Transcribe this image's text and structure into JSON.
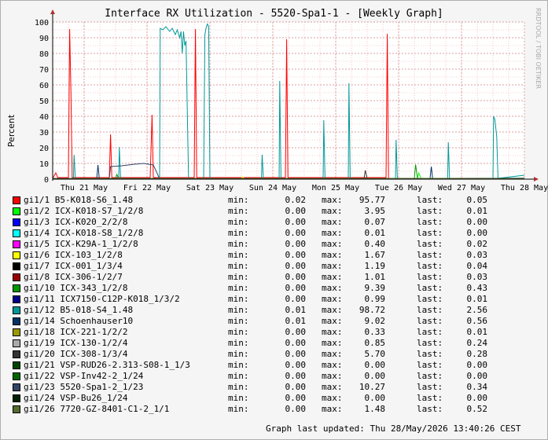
{
  "chart_data": {
    "type": "line",
    "title": "Interface RX Utilization - 5520-Spa1-1 - [Weekly Graph]",
    "ylabel": "Percent",
    "watermark": "RRDTOOL / TOBI OETIKER",
    "ylim": [
      0,
      100
    ],
    "yticks": [
      0,
      10,
      20,
      30,
      40,
      50,
      60,
      70,
      80,
      90,
      100
    ],
    "x_range_days": [
      0,
      7.5
    ],
    "xticks": [
      {
        "label": "Thu 21 May",
        "day": 0.5
      },
      {
        "label": "Fri 22 May",
        "day": 1.5
      },
      {
        "label": "Sat 23 May",
        "day": 2.5
      },
      {
        "label": "Sun 24 May",
        "day": 3.5
      },
      {
        "label": "Mon 25 May",
        "day": 4.5
      },
      {
        "label": "Tue 26 May",
        "day": 5.5
      },
      {
        "label": "Wed 27 May",
        "day": 6.5
      },
      {
        "label": "Thu 28 May",
        "day": 7.5
      }
    ],
    "grid": true,
    "minor_grid": "dotted red",
    "series": [
      {
        "name": "gi1/1 B5-K018-S6_1.48",
        "color": "#ff0000",
        "min": "0.02",
        "max": "95.77",
        "last": "0.05",
        "points": [
          [
            0,
            0.5
          ],
          [
            0.05,
            4
          ],
          [
            0.08,
            1
          ],
          [
            0.25,
            1
          ],
          [
            0.27,
            95.5
          ],
          [
            0.29,
            56
          ],
          [
            0.31,
            1
          ],
          [
            0.9,
            1
          ],
          [
            0.92,
            28.5
          ],
          [
            0.94,
            1
          ],
          [
            1.55,
            1
          ],
          [
            1.58,
            41
          ],
          [
            1.6,
            1
          ],
          [
            2.25,
            1
          ],
          [
            2.27,
            95.5
          ],
          [
            2.29,
            1
          ],
          [
            3.7,
            1
          ],
          [
            3.72,
            89
          ],
          [
            3.74,
            1
          ],
          [
            5.3,
            1
          ],
          [
            5.32,
            92.5
          ],
          [
            5.34,
            0.5
          ],
          [
            7.5,
            0.2
          ]
        ]
      },
      {
        "name": "gi1/2 ICX-K018-S7_1/2/8",
        "color": "#00ff00",
        "min": "0.00",
        "max": "3.95",
        "last": "0.01",
        "points": [
          [
            0,
            0.2
          ],
          [
            5.8,
            0.3
          ],
          [
            5.82,
            3.9
          ],
          [
            5.86,
            0.3
          ],
          [
            7.5,
            0.1
          ]
        ]
      },
      {
        "name": "gi1/3 ICX-K020_2/2/8",
        "color": "#0000ff",
        "min": "0.00",
        "max": "0.07",
        "last": "0.00",
        "points": [
          [
            0,
            0.05
          ],
          [
            7.5,
            0.02
          ]
        ]
      },
      {
        "name": "gi1/4 ICX-K018-S8_1/2/8",
        "color": "#00ffff",
        "min": "0.00",
        "max": "0.01",
        "last": "0.00",
        "points": [
          [
            0,
            0.01
          ],
          [
            7.5,
            0.01
          ]
        ]
      },
      {
        "name": "gi1/5 ICX-K29A-1_1/2/8",
        "color": "#ff00ff",
        "min": "0.00",
        "max": "0.40",
        "last": "0.02",
        "points": [
          [
            0,
            0.1
          ],
          [
            7.5,
            0.1
          ]
        ]
      },
      {
        "name": "gi1/6 ICX-103_1/2/8",
        "color": "#ffff00",
        "min": "0.00",
        "max": "1.67",
        "last": "0.03",
        "points": [
          [
            0,
            0.2
          ],
          [
            3.0,
            0.3
          ],
          [
            3.02,
            1.6
          ],
          [
            3.05,
            0.2
          ],
          [
            7.5,
            0.1
          ]
        ]
      },
      {
        "name": "gi1/7 ICX-001_1/3/4",
        "color": "#000000",
        "min": "0.00",
        "max": "1.19",
        "last": "0.04",
        "points": [
          [
            0,
            0.3
          ],
          [
            7.5,
            0.3
          ]
        ]
      },
      {
        "name": "gi1/8 ICX-306-1/2/7",
        "color": "#990000",
        "min": "0.00",
        "max": "1.01",
        "last": "0.03",
        "points": [
          [
            0,
            0.3
          ],
          [
            7.5,
            0.2
          ]
        ]
      },
      {
        "name": "gi1/10 ICX-343_1/2/8",
        "color": "#009900",
        "min": "0.00",
        "max": "9.39",
        "last": "0.43",
        "points": [
          [
            0,
            0.3
          ],
          [
            1.0,
            0.3
          ],
          [
            1.02,
            3
          ],
          [
            1.05,
            0.5
          ],
          [
            5.75,
            0.5
          ],
          [
            5.77,
            9.3
          ],
          [
            5.8,
            0.5
          ],
          [
            7.5,
            0.4
          ]
        ]
      },
      {
        "name": "gi1/11 ICX7150-C12P-K018_1/3/2",
        "color": "#00008b",
        "min": "0.00",
        "max": "0.99",
        "last": "0.01",
        "points": [
          [
            0,
            0.2
          ],
          [
            7.5,
            0.1
          ]
        ]
      },
      {
        "name": "gi1/12 B5-018-S4_1.48",
        "color": "#009999",
        "min": "0.01",
        "max": "98.72",
        "last": "2.56",
        "points": [
          [
            0,
            0.5
          ],
          [
            0.33,
            0.5
          ],
          [
            0.34,
            15.5
          ],
          [
            0.36,
            0.5
          ],
          [
            1.05,
            0.5
          ],
          [
            1.06,
            20.5
          ],
          [
            1.08,
            0.5
          ],
          [
            1.7,
            0.5
          ],
          [
            1.71,
            96
          ],
          [
            1.75,
            95
          ],
          [
            1.8,
            97
          ],
          [
            1.86,
            94
          ],
          [
            1.9,
            96
          ],
          [
            1.95,
            92
          ],
          [
            1.98,
            95
          ],
          [
            2.02,
            90
          ],
          [
            2.04,
            94
          ],
          [
            2.06,
            80
          ],
          [
            2.08,
            94
          ],
          [
            2.1,
            85
          ],
          [
            2.12,
            88
          ],
          [
            2.16,
            0.5
          ],
          [
            2.4,
            0.5
          ],
          [
            2.42,
            92
          ],
          [
            2.44,
            96.5
          ],
          [
            2.46,
            98.7
          ],
          [
            2.48,
            97
          ],
          [
            2.5,
            0.5
          ],
          [
            3.32,
            0.5
          ],
          [
            3.33,
            15.5
          ],
          [
            3.35,
            0.5
          ],
          [
            3.6,
            0.5
          ],
          [
            3.61,
            62.5
          ],
          [
            3.63,
            0.5
          ],
          [
            4.3,
            0.5
          ],
          [
            4.31,
            37.5
          ],
          [
            4.33,
            0.5
          ],
          [
            4.7,
            0.5
          ],
          [
            4.71,
            61
          ],
          [
            4.73,
            0.5
          ],
          [
            5.45,
            0.5
          ],
          [
            5.46,
            25
          ],
          [
            5.48,
            0.5
          ],
          [
            6.28,
            0.5
          ],
          [
            6.29,
            23.5
          ],
          [
            6.31,
            0.5
          ],
          [
            7.0,
            0.5
          ],
          [
            7.01,
            40
          ],
          [
            7.03,
            38
          ],
          [
            7.06,
            27
          ],
          [
            7.08,
            0.5
          ],
          [
            7.5,
            2.5
          ]
        ]
      },
      {
        "name": "gi1/14 Schoenhauser10",
        "color": "#003366",
        "min": "0.01",
        "max": "9.02",
        "last": "0.56",
        "points": [
          [
            0,
            0.5
          ],
          [
            0.7,
            0.5
          ],
          [
            0.72,
            9
          ],
          [
            0.74,
            0.5
          ],
          [
            6.0,
            0.5
          ],
          [
            6.02,
            8
          ],
          [
            6.04,
            0.5
          ],
          [
            7.5,
            0.6
          ]
        ]
      },
      {
        "name": "gi1/18 ICX-221-1/2/2",
        "color": "#999900",
        "min": "0.00",
        "max": "0.33",
        "last": "0.01",
        "points": [
          [
            0,
            0.1
          ],
          [
            7.5,
            0.05
          ]
        ]
      },
      {
        "name": "gi1/19 ICX-130-1/2/4",
        "color": "#aaaaaa",
        "min": "0.00",
        "max": "0.85",
        "last": "0.24",
        "points": [
          [
            0,
            0.2
          ],
          [
            7.5,
            0.2
          ]
        ]
      },
      {
        "name": "gi1/20 ICX-308-1/3/4",
        "color": "#333333",
        "min": "0.00",
        "max": "5.70",
        "last": "0.28",
        "points": [
          [
            0,
            0.3
          ],
          [
            4.95,
            0.3
          ],
          [
            4.97,
            5.6
          ],
          [
            5.0,
            0.3
          ],
          [
            7.5,
            0.3
          ]
        ]
      },
      {
        "name": "gi1/21 VSP-RUD26-2.313-S08-1_1/3",
        "color": "#004400",
        "min": "0.00",
        "max": "0.00",
        "last": "0.00",
        "points": [
          [
            0,
            0
          ],
          [
            7.5,
            0
          ]
        ]
      },
      {
        "name": "gi1/22 VSP-Inv42-2_1/24",
        "color": "#006600",
        "min": "0.00",
        "max": "0.00",
        "last": "0.00",
        "points": [
          [
            0,
            0
          ],
          [
            7.5,
            0
          ]
        ]
      },
      {
        "name": "gi1/23 5520-Spa1-2_1/23",
        "color": "#334466",
        "min": "0.00",
        "max": "10.27",
        "last": "0.34",
        "points": [
          [
            0,
            0.3
          ],
          [
            0.9,
            0.3
          ],
          [
            0.92,
            8
          ],
          [
            1.1,
            8.5
          ],
          [
            1.3,
            9.5
          ],
          [
            1.45,
            10
          ],
          [
            1.6,
            9
          ],
          [
            1.7,
            0.3
          ],
          [
            7.5,
            0.3
          ]
        ]
      },
      {
        "name": "gi1/24 VSP-Bu26_1/24",
        "color": "#002200",
        "min": "0.00",
        "max": "0.00",
        "last": "0.00",
        "points": [
          [
            0,
            0
          ],
          [
            7.5,
            0
          ]
        ]
      },
      {
        "name": "gi1/26 7720-GZ-8401-C1-2_1/1",
        "color": "#556b2f",
        "min": "0.00",
        "max": "1.48",
        "last": "0.52",
        "points": [
          [
            0,
            0.4
          ],
          [
            7.5,
            0.5
          ]
        ]
      }
    ]
  },
  "legend": {
    "min_label": "min:",
    "max_label": "max:",
    "last_label": "last:"
  },
  "footer": {
    "updated": "Graph last updated: Thu 28/May/2026 13:40:26 CEST"
  }
}
